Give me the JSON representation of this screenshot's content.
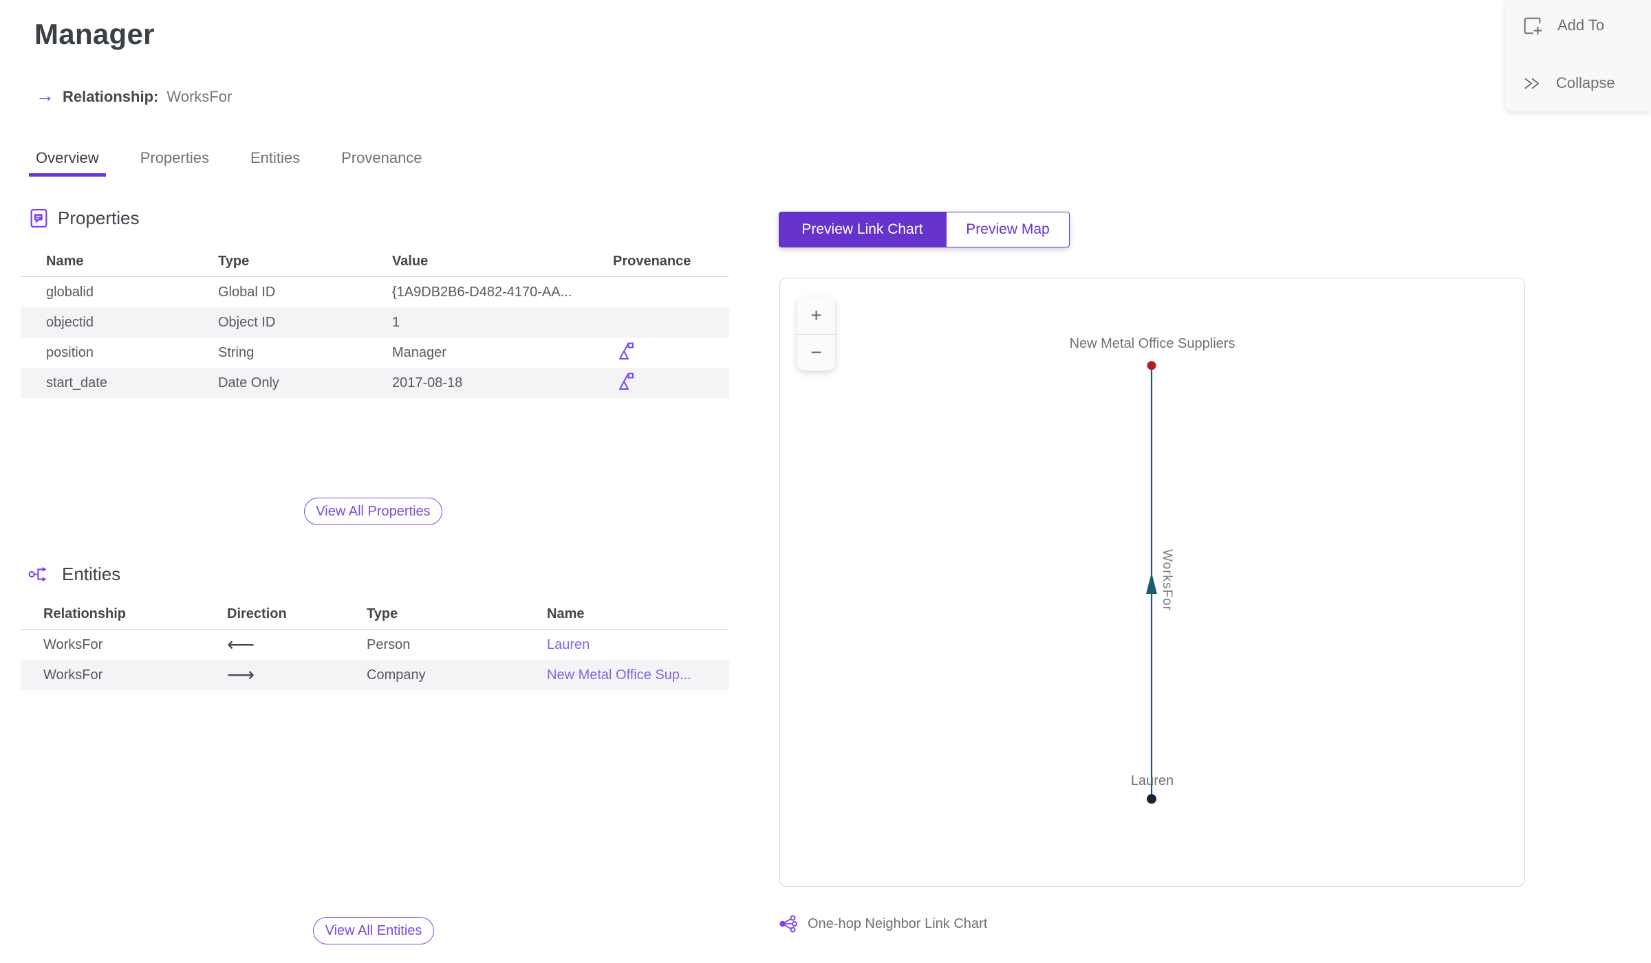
{
  "header": {
    "title": "Manager",
    "relationship_label": "Relationship:",
    "relationship_value": "WorksFor"
  },
  "actions": {
    "add_to_label": "Add To",
    "collapse_label": "Collapse"
  },
  "tabs": [
    {
      "label": "Overview"
    },
    {
      "label": "Properties"
    },
    {
      "label": "Entities"
    },
    {
      "label": "Provenance"
    }
  ],
  "properties_section": {
    "title": "Properties",
    "columns": [
      "Name",
      "Type",
      "Value",
      "Provenance"
    ],
    "rows": [
      {
        "name": "globalid",
        "type": "Global ID",
        "value": "{1A9DB2B6-D482-4170-AA...",
        "provenance": false
      },
      {
        "name": "objectid",
        "type": "Object ID",
        "value": "1",
        "provenance": false
      },
      {
        "name": "position",
        "type": "String",
        "value": "Manager",
        "provenance": true
      },
      {
        "name": "start_date",
        "type": "Date Only",
        "value": "2017-08-18",
        "provenance": true
      }
    ],
    "view_all_label": "View All Properties"
  },
  "entities_section": {
    "title": "Entities",
    "columns": [
      "Relationship",
      "Direction",
      "Type",
      "Name"
    ],
    "rows": [
      {
        "relationship": "WorksFor",
        "direction": "⟵",
        "type": "Person",
        "name": "Lauren"
      },
      {
        "relationship": "WorksFor",
        "direction": "⟶",
        "type": "Company",
        "name": "New Metal Office Sup..."
      }
    ],
    "view_all_label": "View All Entities"
  },
  "preview": {
    "link_chart_tab": "Preview Link Chart",
    "map_tab": "Preview Map",
    "zoom_in": "+",
    "zoom_out": "−",
    "footer_label": "One-hop Neighbor Link Chart"
  },
  "chart_data": {
    "type": "link_chart",
    "nodes": [
      {
        "label": "New Metal Office Suppliers",
        "color": "#b21e1e",
        "position": "top"
      },
      {
        "label": "Lauren",
        "color": "#15233c",
        "position": "bottom"
      }
    ],
    "edges": [
      {
        "label": "WorksFor",
        "source": "Lauren",
        "target": "New Metal Office Suppliers",
        "color": "#1e5a6d"
      }
    ]
  },
  "colors": {
    "accent_purple": "#6633cc",
    "outline_button_purple": "#7a4ce0",
    "icon_purple": "#7c42f2",
    "link_purple": "#8464e4",
    "edge_teal": "#1e5a6d",
    "node_red": "#b21e1e",
    "node_navy": "#15233c",
    "alt_row_bg": "#f4f4f6"
  }
}
